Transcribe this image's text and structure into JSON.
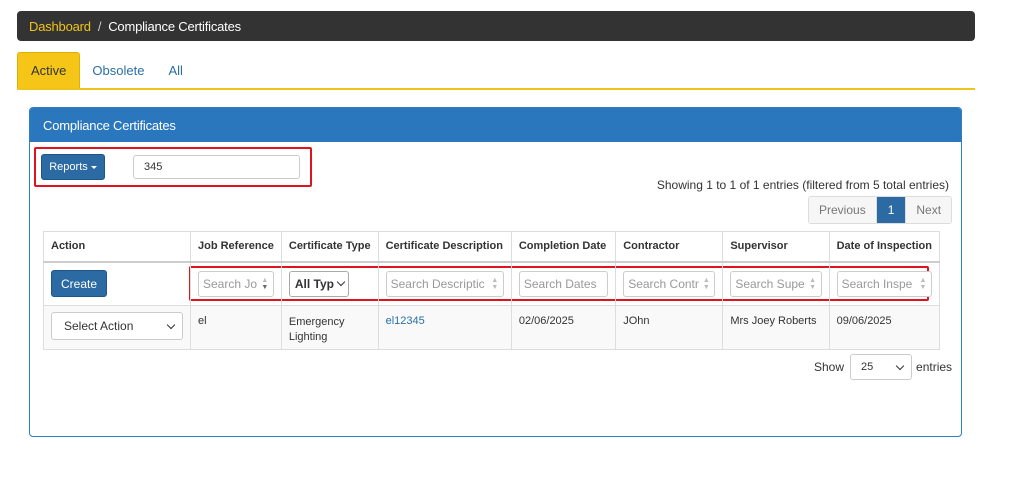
{
  "breadcrumb": {
    "link": "Dashboard",
    "separator": "/",
    "current": "Compliance Certificates"
  },
  "tabs": [
    {
      "label": "Active",
      "active": true
    },
    {
      "label": "Obsolete",
      "active": false
    },
    {
      "label": "All",
      "active": false
    }
  ],
  "panel": {
    "title": "Compliance Certificates"
  },
  "toolbar": {
    "reports_label": "Reports",
    "search_value": "345"
  },
  "info": "Showing 1 to 1 of 1 entries (filtered from 5 total entries)",
  "pagination": {
    "previous": "Previous",
    "page": "1",
    "next": "Next"
  },
  "table": {
    "headers": [
      "Action",
      "Job Reference",
      "Certificate Type",
      "Certificate Description",
      "Completion Date",
      "Contractor",
      "Supervisor",
      "Date of Inspection"
    ],
    "create_label": "Create",
    "filters": {
      "job_reference": "Search Jo",
      "certificate_type": "All Typ",
      "description": "Search Descriptic",
      "completion_date": "Search Dates",
      "contractor": "Search Contr",
      "supervisor": "Search Supe",
      "inspection": "Search Inspe"
    },
    "rows": [
      {
        "action": "Select Action",
        "job_reference": "el",
        "certificate_type": "Emergency Lighting",
        "description": "el12345",
        "completion_date": "02/06/2025",
        "contractor": "JOhn",
        "supervisor": "Mrs Joey Roberts",
        "inspection": "09/06/2025"
      }
    ]
  },
  "length": {
    "show": "Show",
    "value": "25",
    "entries": "entries"
  },
  "colors": {
    "accent": "#f5c518",
    "primary": "#2b6aa3",
    "highlight": "#e0141e"
  }
}
